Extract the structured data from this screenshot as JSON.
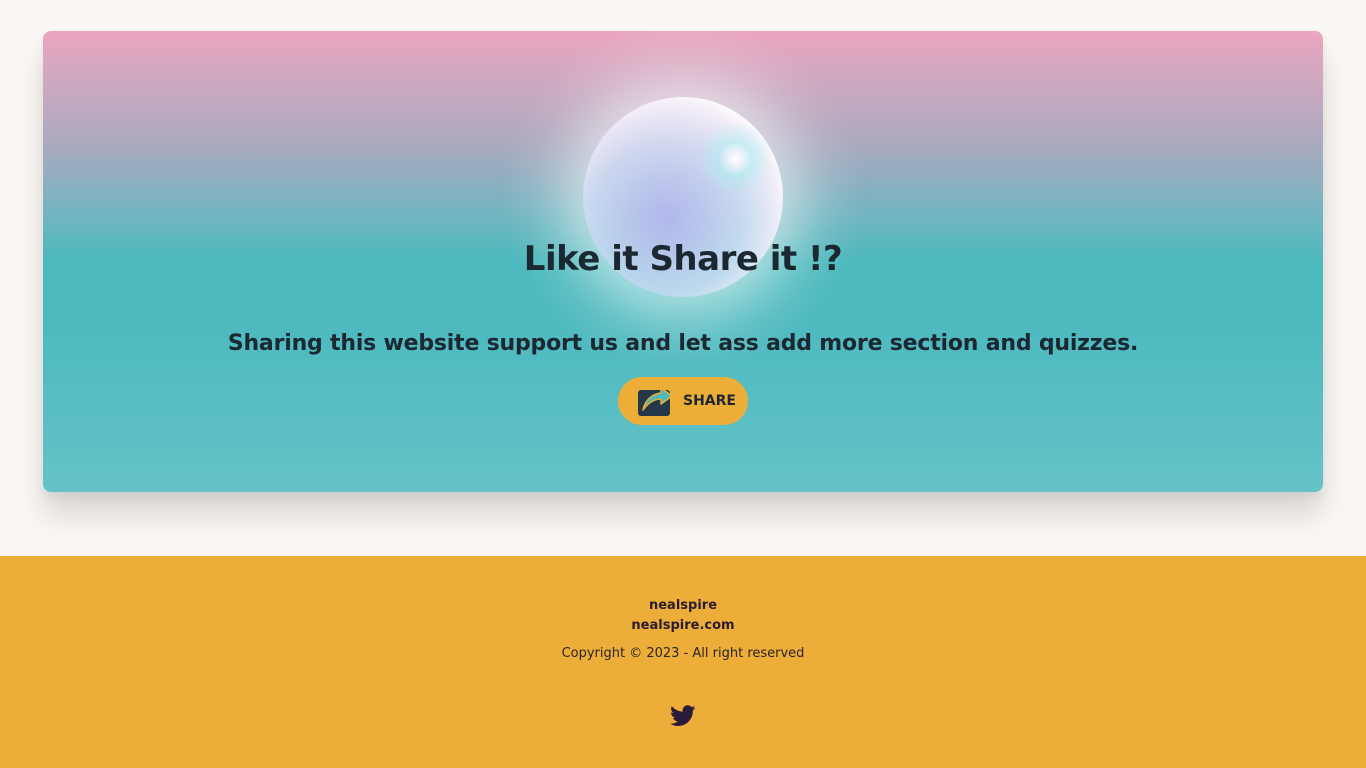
{
  "hero": {
    "title": "Like it Share it !?",
    "subtitle": "Sharing this website support us and let ass add more section and quizzes.",
    "share_button": {
      "label": "SHARE",
      "icon": "share-arrow-icon"
    }
  },
  "footer": {
    "brand": "nealspire",
    "domain": "nealspire.com",
    "copyright": "Copyright © 2023 - All right reserved",
    "social": [
      {
        "icon": "twitter-icon"
      }
    ]
  },
  "colors": {
    "page_background": "#fbf7f4",
    "hero_top": "#eba5bf",
    "hero_mid": "#4bb9bd",
    "hero_bottom": "#65c3c8",
    "accent": "#edae37",
    "text_dark": "#1b2731",
    "footer_text": "#2a1b30"
  }
}
